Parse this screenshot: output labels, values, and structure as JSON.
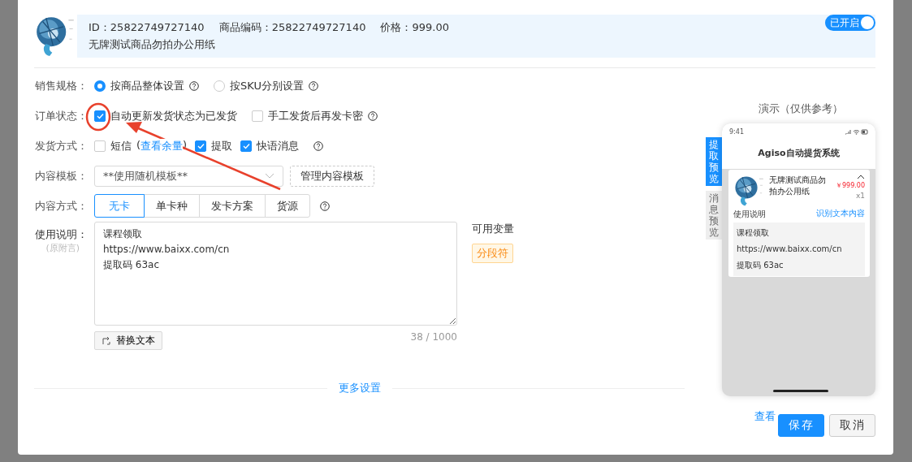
{
  "product": {
    "id": "ID：25822749727140",
    "code": "商品编码：25822749727140",
    "price": "价格：999.00",
    "name": "无牌测试商品勿拍办公用纸"
  },
  "toggle": {
    "label": "已开启",
    "on": true
  },
  "sale_spec": {
    "label": "销售规格：",
    "options": [
      {
        "label": "按商品整体设置",
        "selected": true,
        "help": true
      },
      {
        "label": "按SKU分别设置",
        "selected": false,
        "help": true
      }
    ]
  },
  "order_status": {
    "label": "订单状态：",
    "options": [
      {
        "label": "自动更新发货状态为已发货",
        "checked": true,
        "help": false
      },
      {
        "label": "手工发货后再发卡密",
        "checked": false,
        "help": true
      }
    ]
  },
  "delivery": {
    "label": "发货方式：",
    "options": [
      {
        "label": "短信",
        "checked": false,
        "link_prefix": "(",
        "link": "查看余量",
        "link_suffix": ")"
      },
      {
        "label": "提取",
        "checked": true
      },
      {
        "label": "快语消息",
        "checked": true
      }
    ],
    "help": true
  },
  "template": {
    "label": "内容模板：",
    "value": "**使用随机模板**",
    "manage_button": "管理内容模板"
  },
  "content_mode": {
    "label": "内容方式：",
    "options": [
      {
        "label": "无卡",
        "selected": true
      },
      {
        "label": "单卡种",
        "selected": false
      },
      {
        "label": "发卡方案",
        "selected": false
      },
      {
        "label": "货源",
        "selected": false
      }
    ],
    "help": true
  },
  "usage": {
    "label": "使用说明：",
    "sublabel": "(原附言)",
    "value": "课程领取\nhttps://www.baixx.com/cn\n提取码 63ac",
    "counter": "38 / 1000",
    "replace_button": "替换文本"
  },
  "variables": {
    "title": "可用变量",
    "tags": [
      "分段符"
    ]
  },
  "more_settings": "更多设置",
  "preview": {
    "title": "演示（仅供参考）",
    "side_tabs": [
      {
        "label": "提取预览",
        "selected": true
      },
      {
        "label": "消息预览",
        "selected": false
      }
    ],
    "phone": {
      "time": "9:41",
      "app_title": "Agiso自动提货系统",
      "product_name": "无牌测试商品勿拍办公用纸",
      "price": "￥999.00",
      "qty": "x1",
      "usage_label": "使用说明",
      "usage_link": "识别文本内容",
      "lines": [
        "课程领取",
        "https://www.baixx.com/cn",
        "提取码 63ac"
      ]
    }
  },
  "footer": {
    "link": "查看",
    "buttons": [
      {
        "label": "保存",
        "kind": "primary"
      },
      {
        "label": "取消",
        "kind": "default"
      }
    ]
  }
}
